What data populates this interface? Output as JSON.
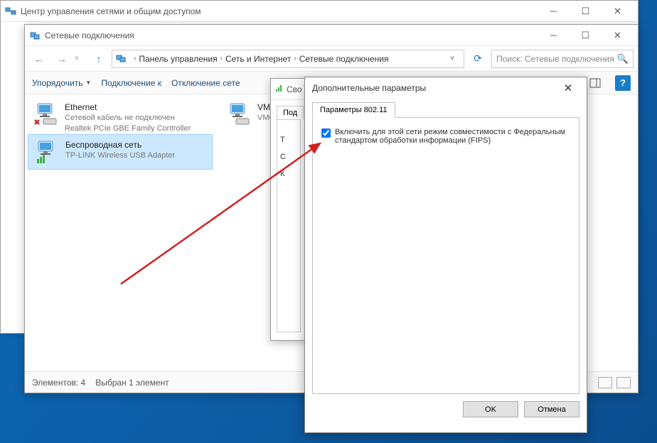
{
  "window1": {
    "title": "Центр управления сетями и общим доступом"
  },
  "window2": {
    "title": "Сетевые подключения",
    "breadcrumb": {
      "item1": "Панель управления",
      "item2": "Сеть и Интернет",
      "item3": "Сетевые подключения"
    },
    "search_placeholder": "Поиск: Сетевые подключения",
    "toolbar": {
      "organize": "Упорядочить",
      "connect": "Подключение к",
      "disconnect": "Отключение сете"
    },
    "items": {
      "ethernet": {
        "title": "Ethernet",
        "status": "Сетевой кабель не подключен",
        "adapter": "Realtek PCIe GBE Family Controller"
      },
      "vmware": {
        "title": "VMw",
        "status": "",
        "adapter": "VMw"
      },
      "wireless": {
        "title": "Беспроводная сеть",
        "status": "",
        "adapter": "TP-LINK Wireless USB Adapter"
      }
    },
    "statusbar": {
      "count": "Элементов: 4",
      "selected": "Выбран 1 элемент"
    }
  },
  "window3": {
    "title": "Сво",
    "tab": "Под",
    "lines": {
      "l1": "",
      "l2": "T",
      "l3": "С",
      "l4": "К"
    }
  },
  "window4": {
    "title": "Дополнительные параметры",
    "tab": "Параметры 802.11",
    "checkbox_label": "Включить для этой сети режим совместимости с Федеральным стандартом обработки информации (FIPS)",
    "ok": "OK",
    "cancel": "Отмена"
  }
}
